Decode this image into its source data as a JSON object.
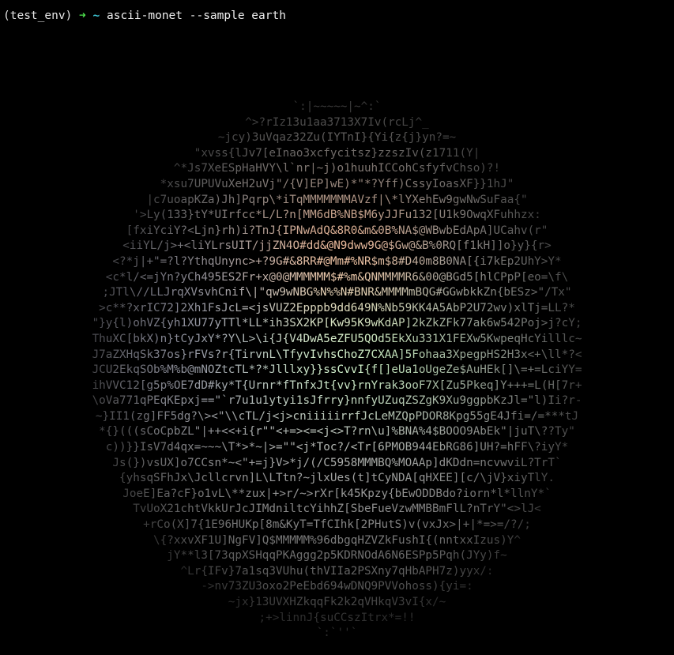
{
  "prompt": {
    "env": "(test_env)",
    "arrow": "➜",
    "dir": "~",
    "command": "ascii-monet --sample earth"
  },
  "colors": {
    "background": "#000000",
    "arrow": "#4ee34e",
    "dir": "#3fc7d6"
  },
  "art_lines": [
    "`:|~~~~~|~^:`",
    "^>?rIz13u1aa3713X7Iv(rcLj^_",
    "~jcy)3uVqaz32Zu(IYTnI}{Yi{z{j}yn?=~",
    "\"xvss{lJv7[eInao3xcfycitsz}zzszIv(z1711(Y|",
    "^*Js7XeESpHaHVY\\l`nr|~j)o1huuhICCohCsfyfvChso)?!",
    "*xsu7UPUVuXeH2uVj\"/{V]EP]wE)*\"*?Yff)CssyIoasXF}}1hJ\"",
    "|c7uoapKZa)Jh]Pqrp\\*iTqMMMMMMMAVzf|\\*lYXehEw9gwNwSuFaa{\"",
    "'>Ly(133}tY*UIrfcc*L/L?n[MM6dB%NB$M6yJJFu132[U1k9OwqXFuhhzx:",
    "[fxiYciY?<Ljn}rh)i?TnJ{IPNwAdQ&8R0&m&0B%NA$@WBwbEdApA]UCahv(r\"",
    "<iiYL/j>+<liYLrsUIT/jjZN4O#dd&@N9dww9G@$Gw@&B%0RQ[f1kH]]o}y}{r>",
    "<?*j|+\"=?l?YthqUnync>+?9G#&8RR#@Mm#%NR$m$8#D40m8B0NA[{i7kEp2UhY>Y*",
    "<c*l/<=jYn?yCh495ES2Fr+x@0@MMMMMM$#%m&QNMMMMR6&00@BGd5[hlCPpP[eo=\\f\\",
    ";JTl\\//LLJrqXVsvhCnif\\|\"qw9wNBG%N%%N#BNR&MMMMmBQG#GGwbkkZn{bESz>\"/Tx\"",
    ">c**?xrIC72]2Xh1FsJcL=<jsVUZ2Epppb9dd649N%Nb59KK4A5AbP2U72wv)xlTj=LL?*",
    "\"}y{l)ohVZ{yh1XU77yTTl*LL*ih3SX2KP[Kw95K9wKdAP]2kZkZFk77ak6w542Poj>j?cY;",
    "ThuXC[bkX)n}tCyJxY*?Y\\L>\\i{J{V4DwA5eZFU5QOd5EkXu331X1FEXw5KwpeqHcYilllc~",
    "J7aZXHqSk37os}rFVs?r{TirvnL\\TfyvIvhsChoZ7CXAA]5Fohaa3XpegpHS2H3x<+\\ll*?<",
    "JCU2EkqSOb%M%b@mNOZtcTL*?*Jlllxy}}ssCvvI{f[]eUa1oUgeZe$AuHEk[]\\=+=LciYY=",
    "ihVVC12[g5p%OE7dD#ky*T{Urnr*fTnfxJt{vv}rnYrak3ooF7X[Zu5Pkeq]Y+++=L(H[7r+",
    "\\oVa771qPEqKEpxj==\"`r7u1u1ytyi1sJfrry}nnfyUZuqZSZgK9Xu9ggpbKzJl=\"l)Ii?r-",
    "~}II1(zg]FF5dg?\\><\"\\\\cTL/j<j>cniiiiirrfJcLeMZQpPDOR8Kpg55gE4Jfi=/=***tJ",
    "*{}(((sCoCpbZL\"|++<<+i{r\"\"<+=><=<j<>T?rn\\u]%BNA%4$BOOO9AbEk\"|juT\\??Ty\"",
    "c))}}IsV7d4qx=~~~\\T*>*~|>=\"\"<j*Toc?/<Tr[6PMOB944EbRG86]UH?=hFF\\?iyY*",
    "Js(})vsUX]o7CCsn*~<\"+=j}V>*j/(/C5958MMMBQ%MOAAp]dKDdn=ncvwviL?TrT`",
    "{yhsqSFhJx\\Jcllcrvn]L\\LTtn?~jlxUes(t]tCyNDA[qHXEE][c/\\jV}xiyTlY.",
    "JoeE]Ea?cF}o1vL\\**zux|+>r/~>rXr[k45Kpzy{bEwODDBdo?iorn*l*llnY*`",
    "TvUoX21chtVkkUrJcJIMdniltcYihhZ[SbeFueVzwMMBBmFlL?nTrY\"<>lJ<",
    "+rCo(X]7{1E96HUKp[8m&KyT=TfCIhk[2PHutS)v(vxJx>|+|*=>=/?/;",
    "\\{?xxvXF1U]NgFV]Q$MMMMM%96dbgqHZVZkFushI{(nntxxIzus)Y^",
    "jY**l3[73qpXSHqqPKAggg2p5KDRNOdA6N6ESPp5Pqh(JYy)f~",
    "^Lr{IFv}7a1sq3VUhu(thVIIa2PSXny7qHbAPH7z)yyx/:",
    "->nv73ZU3oxo2PeEbd694wDNQ9PVVohoss){yi=:",
    "~jx}13UVXHZkqqFk2k2qVHkqV3vI{x/~",
    ";+>linnJ{suCCszItrx*=!!",
    "`:`''`"
  ]
}
